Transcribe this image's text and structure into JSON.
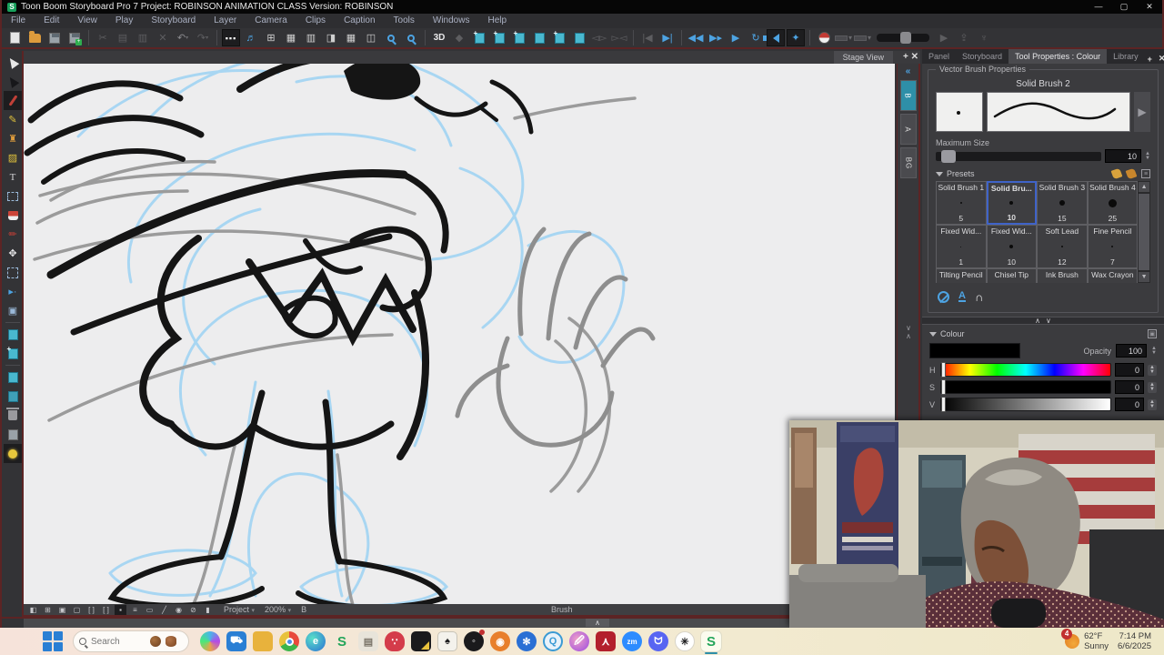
{
  "window": {
    "logo_letter": "S",
    "title": "Toon Boom Storyboard Pro 7 Project: ROBINSON ANIMATION CLASS Version: ROBINSON",
    "minimize": "—",
    "maximize": "▢",
    "close": "✕"
  },
  "menus": [
    "File",
    "Edit",
    "View",
    "Play",
    "Storyboard",
    "Layer",
    "Camera",
    "Clips",
    "Caption",
    "Tools",
    "Windows",
    "Help"
  ],
  "toolbar": {
    "threed_label": "3D"
  },
  "stage": {
    "tab_label": "Stage View",
    "tab_add": "+",
    "tab_close": "✕",
    "collapse_glyph": "«",
    "layer_tabs": [
      "B",
      "A",
      "BG"
    ],
    "statusbar": {
      "project_label": "Project",
      "zoom_level": "200%",
      "mode_label": "B",
      "tool_label": "Brush"
    }
  },
  "panel": {
    "tabs": [
      "Panel",
      "Storyboard",
      "Tool Properties : Colour",
      "Library"
    ],
    "tab_add": "+",
    "tab_close": "✕",
    "brush": {
      "section_title": "Vector Brush Properties",
      "name": "Solid Brush 2",
      "max_size_label": "Maximum Size",
      "max_size_value": "10"
    },
    "presets": {
      "header": "Presets",
      "items": [
        {
          "name": "Solid Brush 1",
          "size": "5"
        },
        {
          "name": "Solid Bru...",
          "size": "10"
        },
        {
          "name": "Solid Brush 3",
          "size": "15"
        },
        {
          "name": "Solid Brush 4",
          "size": "25"
        },
        {
          "name": "Fixed Wid...",
          "size": "1"
        },
        {
          "name": "Fixed Wid...",
          "size": "10"
        },
        {
          "name": "Soft Lead",
          "size": "12"
        },
        {
          "name": "Fine Pencil",
          "size": "7"
        },
        {
          "name": "Tilting Pencil",
          "size": ""
        },
        {
          "name": "Chisel Tip",
          "size": ""
        },
        {
          "name": "Ink Brush",
          "size": ""
        },
        {
          "name": "Wax Crayon",
          "size": ""
        }
      ]
    },
    "colour": {
      "header": "Colour",
      "opacity_label": "Opacity",
      "opacity_value": "100",
      "h_label": "H",
      "s_label": "S",
      "v_label": "V",
      "h_value": "0",
      "s_value": "0",
      "v_value": "0",
      "swatch_color": "#000000"
    }
  },
  "taskbar": {
    "search_placeholder": "Search",
    "icons": [
      "start",
      "search",
      "copilot",
      "store",
      "file-explorer",
      "chrome",
      "edge",
      "app-s-green",
      "notepad",
      "red-app",
      "black-yellow-app",
      "solitaire",
      "vinyl-record",
      "blender",
      "blue-snowflake-app",
      "quicktime",
      "paint-app",
      "acrobat",
      "zoom",
      "discord",
      "chatgpt",
      "storyboard-pro-active"
    ],
    "zoom_label": "zm",
    "tray": {
      "badge": "4",
      "temperature": "62°F",
      "condition": "Sunny",
      "time": "7:14 PM",
      "date": "6/6/2025"
    }
  },
  "colors": {
    "accent_blue": "#4da3e2",
    "maroon_border": "#5c2424",
    "selected_preset_border": "#3f63c8",
    "sketch_blue": "#a5d5f3",
    "taskbar_tint": "#f3ead2"
  }
}
